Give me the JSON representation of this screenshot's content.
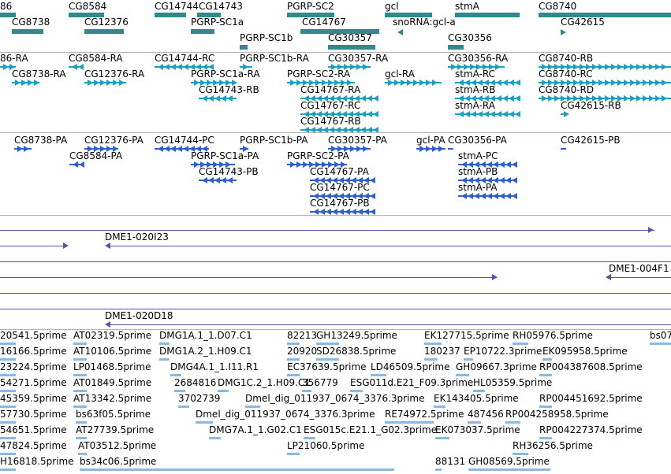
{
  "colors": {
    "gene": "#2e8b8b",
    "mrna": "#1aa0c0",
    "protein": "#2f5fd0",
    "clone": "#6a4aa8",
    "est": "#8ab8e0",
    "sep": "#b4b4b4"
  },
  "gene_track": {
    "labels": [
      "86",
      "CG8584",
      "CG14744",
      "CG14743",
      "PGRP-SC2",
      "gcl",
      "stmA",
      "CG8740",
      "CG8738",
      "CG12376",
      "PGRP-SC1a",
      "CG14767",
      "snoRNA:gcl-a",
      "CG42615",
      "PGRP-SC1b",
      "CG30357",
      "CG30356"
    ]
  },
  "mrna_track": {
    "labels": [
      "86-RA",
      "CG8584-RA",
      "CG14744-RC",
      "PGRP-SC1b-RA",
      "CG30357-RA",
      "CG30356-RA",
      "CG8740-RB",
      "CG8738-RA",
      "CG12376-RA",
      "PGRP-SC1a-RA",
      "PGRP-SC2-RA",
      "gcl-RA",
      "stmA-RC",
      "CG8740-RC",
      "CG14743-RB",
      "CG14767-RA",
      "stmA-RB",
      "CG8740-RD",
      "CG14767-RC",
      "stmA-RA",
      "CG42615-RB",
      "CG14767-RB"
    ]
  },
  "protein_track": {
    "labels": [
      "CG8738-PA",
      "CG12376-PA",
      "CG14744-PC",
      "PGRP-SC1b-PA",
      "CG30357-PA",
      "gcl-PA",
      "CG30356-PA",
      "CG42615-PB",
      "CG8584-PA",
      "PGRP-SC1a-PA",
      "PGRP-SC2-PA",
      "stmA-PC",
      "CG14743-PB",
      "CG14767-PA",
      "stmA-PB",
      "CG14767-PC",
      "stmA-PA",
      "CG14767-PB"
    ]
  },
  "clone_track": {
    "labels": [
      "DME1-020I23",
      "DME1-004F1",
      "DME1-020D18"
    ]
  },
  "est_track": {
    "labels": [
      "20541.5prime",
      "AT02319.5prime",
      "DMG1A.1_1.D07.C1",
      "82213",
      "GH13249.5prime",
      "EK127715.5prime",
      "RH05976.5prime",
      "bs07",
      "16166.5prime",
      "AT10106.5prime",
      "DMG1A.2_1.H09.C1",
      "20920",
      "SD26838.5prime",
      "180237",
      "EP10722.3prime",
      "EK095958.5prime",
      "23224.5prime",
      "LP01468.5prime",
      "DMG4A.1_1.I11.R1",
      "EC37639.5prime",
      "LD46509.5prime",
      "GH09667.3prime",
      "RP004387608.5prime",
      "54271.5prime",
      "AT01849.5prime",
      "2684816",
      "DMG1C.2_1.H09.C1",
      "356779",
      "ESG011d.E21_F09.3prime",
      "HL05359.5prime",
      "45359.5prime",
      "AT13342.5prime",
      "3702739",
      "Dmel_dig_011937_0674_3376.3prime",
      "EK143405.5prime",
      "RP004451692.5prime",
      "57730.5prime",
      "bs63f05.5prime",
      "Dmel_dig_011937_0674_3376.3prime",
      "RE74972.5prime",
      "487456",
      "RP004258958.5prime",
      "54651.5prime",
      "AT27739.5prime",
      "DMG7A.1_1.G02.C1",
      "ESG015c.E21.1_G02.3prime",
      "EK073037.5prime",
      "RP004227374.5prime",
      "47824.5prime",
      "AT03512.5prime",
      "LP21060.5prime",
      "RH36256.5prime",
      "H16818.5prime",
      "bs34c06.5prime",
      "88131",
      "GH08569.5prime"
    ]
  }
}
